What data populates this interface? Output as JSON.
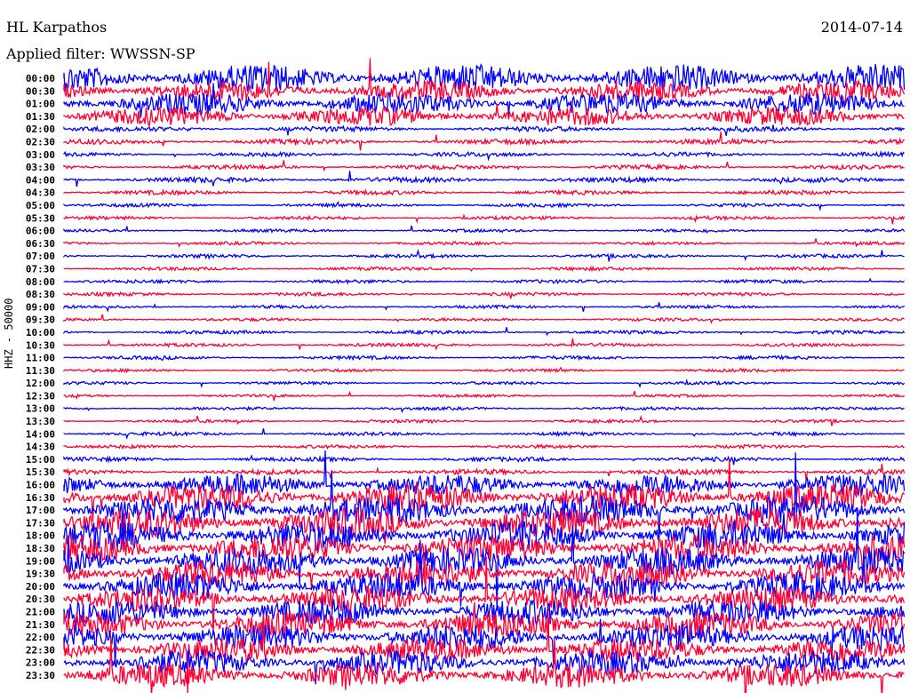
{
  "header": {
    "station": "HL Karpathos",
    "date": "2014-07-14",
    "filter": "Applied filter: WWSSN-SP"
  },
  "chart_data": {
    "type": "line",
    "title": "HL Karpathos",
    "ylabel": "HHZ - 50000",
    "row_labels": [
      "00:00",
      "00:30",
      "01:00",
      "01:30",
      "02:00",
      "02:30",
      "03:00",
      "03:30",
      "04:00",
      "04:30",
      "05:00",
      "05:30",
      "06:00",
      "06:30",
      "07:00",
      "07:30",
      "08:00",
      "08:30",
      "09:00",
      "09:30",
      "10:00",
      "10:30",
      "11:00",
      "11:30",
      "12:00",
      "12:30",
      "13:00",
      "13:30",
      "14:00",
      "14:30",
      "15:00",
      "15:30",
      "16:00",
      "16:30",
      "17:00",
      "17:30",
      "18:00",
      "18:30",
      "19:00",
      "19:30",
      "20:00",
      "20:30",
      "21:00",
      "21:30",
      "22:00",
      "22:30",
      "23:00",
      "23:30"
    ],
    "relative_amplitude": [
      3.2,
      2.4,
      2.6,
      2.2,
      0.6,
      0.6,
      0.5,
      0.5,
      0.6,
      0.5,
      0.4,
      0.4,
      0.35,
      0.35,
      0.4,
      0.4,
      0.4,
      0.4,
      0.35,
      0.35,
      0.4,
      0.4,
      0.4,
      0.35,
      0.35,
      0.3,
      0.35,
      0.35,
      0.4,
      0.4,
      0.5,
      0.6,
      2.5,
      3.2,
      3.4,
      3.4,
      3.4,
      3.2,
      3.2,
      3.2,
      3.2,
      3.0,
      3.0,
      3.0,
      3.0,
      2.8,
      2.8,
      2.8
    ],
    "colors": {
      "hour": "#0000ff",
      "half_hour": "#ff0033"
    }
  }
}
